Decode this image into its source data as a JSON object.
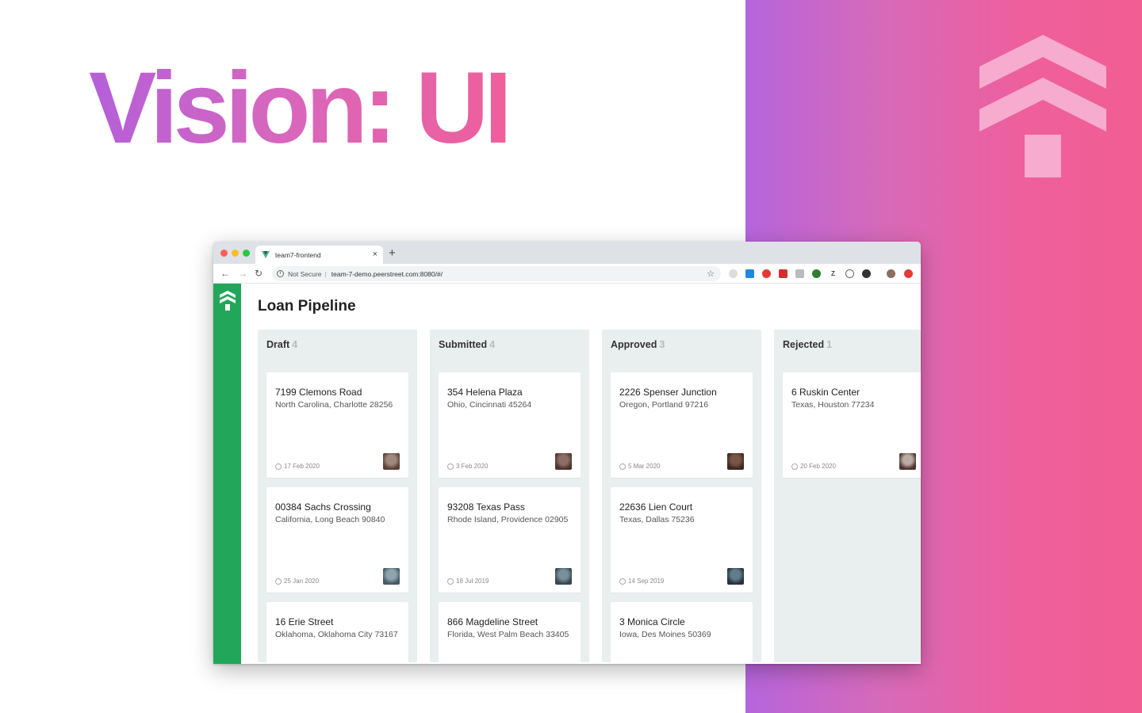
{
  "hero": {
    "title": "Vision: UI"
  },
  "colors": {
    "accent_green": "#22a659",
    "gradient_start": "#b565dc",
    "gradient_end": "#f25e92"
  },
  "browser": {
    "tab_title": "team7-frontend",
    "security": "Not Secure",
    "url": "team-7-demo.peerstreet.com:8080/#/",
    "extensions": [
      "ext-1",
      "ext-2",
      "ext-3",
      "ext-4",
      "ext-5",
      "ext-6",
      "ext-7",
      "ext-8",
      "ext-9",
      "ext-10",
      "ext-11",
      "ext-12"
    ]
  },
  "app": {
    "title": "Loan Pipeline",
    "columns": [
      {
        "name": "Draft",
        "count": "4",
        "cards": [
          {
            "street": "7199 Clemons Road",
            "city": "North Carolina, Charlotte 28256",
            "date": "17 Feb 2020"
          },
          {
            "street": "00384 Sachs Crossing",
            "city": "California, Long Beach 90840",
            "date": "25 Jan 2020"
          },
          {
            "street": "16 Erie Street",
            "city": "Oklahoma, Oklahoma City 73167",
            "date": ""
          }
        ]
      },
      {
        "name": "Submitted",
        "count": "4",
        "cards": [
          {
            "street": "354 Helena Plaza",
            "city": "Ohio, Cincinnati 45264",
            "date": "3 Feb 2020"
          },
          {
            "street": "93208 Texas Pass",
            "city": "Rhode Island, Providence 02905",
            "date": "18 Jul 2019"
          },
          {
            "street": "866 Magdeline Street",
            "city": "Florida, West Palm Beach 33405",
            "date": ""
          }
        ]
      },
      {
        "name": "Approved",
        "count": "3",
        "cards": [
          {
            "street": "2226 Spenser Junction",
            "city": "Oregon, Portland 97216",
            "date": "5 Mar 2020"
          },
          {
            "street": "22636 Lien Court",
            "city": "Texas, Dallas 75236",
            "date": "14 Sep 2019"
          },
          {
            "street": "3 Monica Circle",
            "city": "Iowa, Des Moines 50369",
            "date": ""
          }
        ]
      },
      {
        "name": "Rejected",
        "count": "1",
        "cards": [
          {
            "street": "6 Ruskin Center",
            "city": "Texas, Houston 77234",
            "date": "20 Feb 2020"
          }
        ]
      }
    ]
  }
}
